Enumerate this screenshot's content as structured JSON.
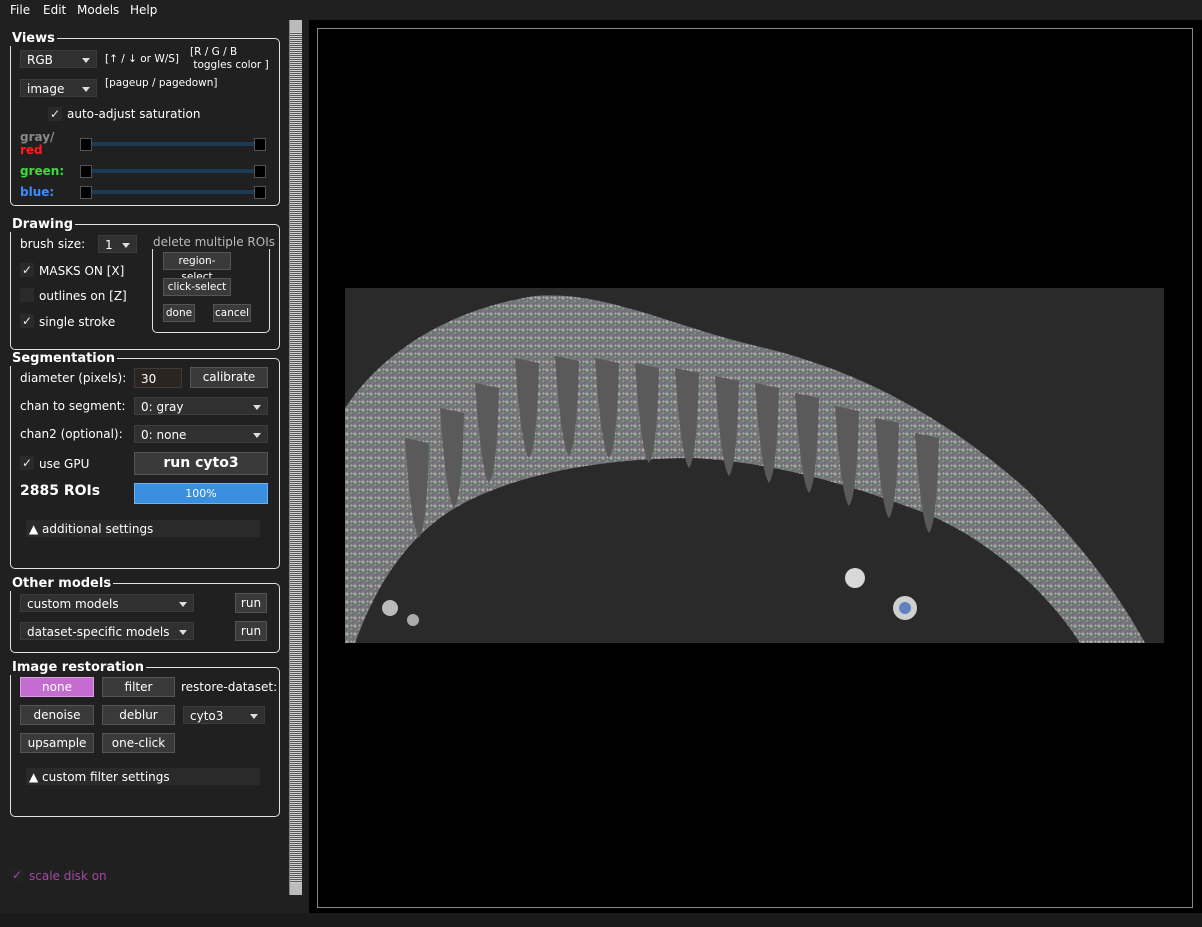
{
  "menu": {
    "items": [
      "File",
      "Edit",
      "Models",
      "Help"
    ]
  },
  "views": {
    "title": "Views",
    "color_mode": "RGB",
    "hint_keys": "[↑ / ↓ or W/S]",
    "hint_toggle": "[R / G / B\n toggles color ]",
    "view_mode": "image",
    "hint_page": "[pageup / pagedown]",
    "auto_adjust_label": "auto-adjust saturation",
    "sliders": [
      {
        "label_a": "gray/",
        "label_b": "red",
        "color": "#ff1a1a"
      },
      {
        "label": "green:",
        "color": "#3cdc3c"
      },
      {
        "label": "blue:",
        "color": "#3c8cff"
      }
    ]
  },
  "drawing": {
    "title": "Drawing",
    "brush_label": "brush size:",
    "brush_value": "1",
    "masks_label": "MASKS ON [X]",
    "outlines_label": "outlines on [Z]",
    "single_stroke_label": "single stroke",
    "delete_title": "delete multiple ROIs",
    "region_select": "region-select",
    "click_select": "click-select",
    "done": "done",
    "cancel": "cancel"
  },
  "segmentation": {
    "title": "Segmentation",
    "diameter_label": "diameter (pixels):",
    "diameter_value": "30",
    "calibrate": "calibrate",
    "chan_label": "chan to segment:",
    "chan_value": "0: gray",
    "chan2_label": "chan2 (optional):",
    "chan2_value": "0: none",
    "gpu_label": "use GPU",
    "run_label": "run cyto3",
    "roi_count": "2885 ROIs",
    "progress_text": "100%",
    "progress": 1.0,
    "additional": "▲ additional settings"
  },
  "other_models": {
    "title": "Other models",
    "custom": "custom models",
    "dataset": "dataset-specific models",
    "run": "run"
  },
  "restoration": {
    "title": "Image restoration",
    "none": "none",
    "filter": "filter",
    "restore_label": "restore-dataset:",
    "denoise": "denoise",
    "deblur": "deblur",
    "dataset_value": "cyto3",
    "upsample": "upsample",
    "one_click": "one-click",
    "custom_filter": "▲ custom filter settings"
  },
  "scale_disk": "scale disk on",
  "colors": {
    "accent": "#3a8fe0",
    "none_button": "#c56cd0",
    "scale_disk": "#a347a3"
  }
}
